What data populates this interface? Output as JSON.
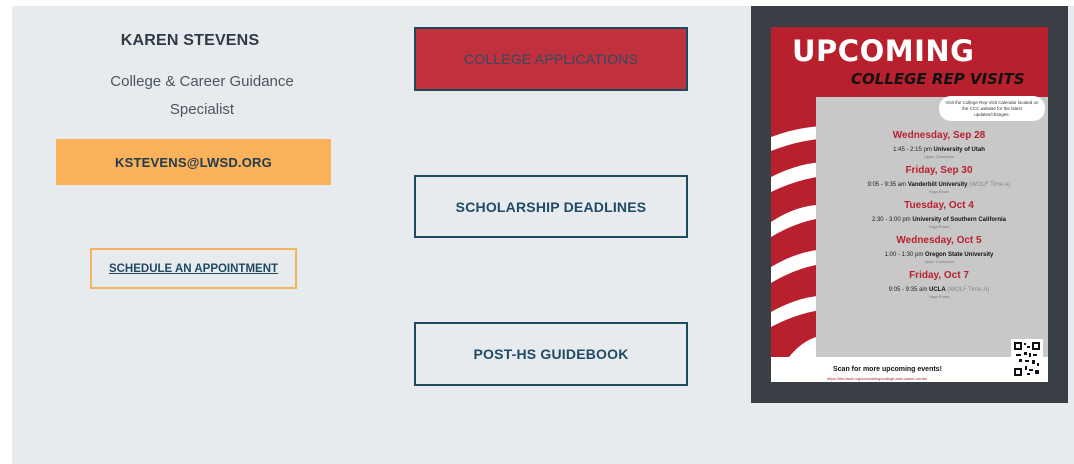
{
  "contact": {
    "name": "KAREN STEVENS",
    "role_line1": "College & Career Guidance",
    "role_line2": "Specialist",
    "email_button": "KSTEVENS@LWSD.ORG",
    "appointment_link": "SCHEDULE AN APPOINTMENT"
  },
  "links": {
    "college_applications": "COLLEGE APPLICATIONS",
    "scholarship_deadlines": "SCHOLARSHIP DEADLINES",
    "post_hs_guidebook": "POST-HS GUIDEBOOK"
  },
  "flyer": {
    "title": "UPCOMING",
    "subtitle": "COLLEGE REP VISITS",
    "note": "Visit the College Rep Visit Calendar located on the CCC website for the latest updates/changes.",
    "events": [
      {
        "date": "Wednesday, Sep 28",
        "time": "1:45 - 2:15 pm",
        "school": "University of Utah",
        "extra": "",
        "room": "Upper Commons"
      },
      {
        "date": "Friday, Sep 30",
        "time": "9:05 - 9:35 am",
        "school": "Vanderbilt University",
        "extra": "(WOLF Time A)",
        "room": "Yoga Room"
      },
      {
        "date": "Tuesday, Oct 4",
        "time": "2:30 - 3:00 pm",
        "school": "University of Southern California",
        "extra": "",
        "room": "Yoga Room"
      },
      {
        "date": "Wednesday, Oct 5",
        "time": "1:00 - 1:30 pm",
        "school": "Oregon State University",
        "extra": "",
        "room": "Upper Commons"
      },
      {
        "date": "Friday, Oct 7",
        "time": "9:05 - 9:35 am",
        "school": "UCLA",
        "extra": "(WOLF Time-A)",
        "room": "Yoga Room"
      }
    ],
    "footer_text": "Scan for more upcoming events!",
    "footer_url": "https://lhs.lwsd.org/counseling/college-and-career-center"
  },
  "colors": {
    "panel_bg": "#e8ebee",
    "accent_red": "#c0303d",
    "accent_orange": "#f9b15a",
    "navy": "#1e4a5e"
  }
}
